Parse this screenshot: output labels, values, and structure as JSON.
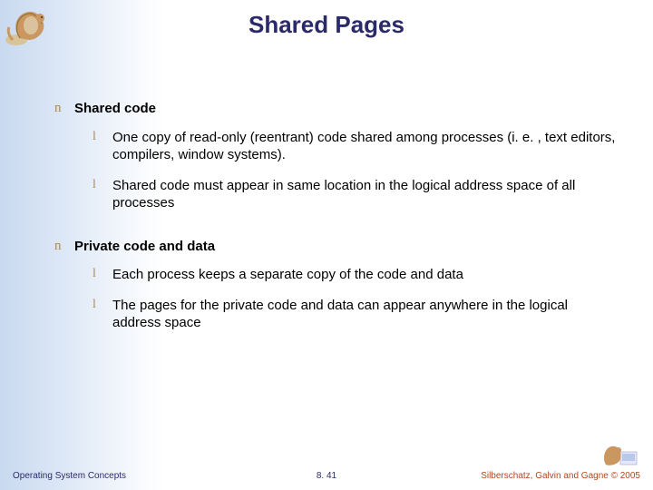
{
  "title": "Shared Pages",
  "sections": [
    {
      "label": "Shared code",
      "items": [
        "One copy of read-only (reentrant) code shared among processes (i. e. , text editors, compilers, window systems).",
        "Shared code must appear in same location in the logical address space of all processes"
      ]
    },
    {
      "label": "Private code and data",
      "items": [
        "Each process keeps a separate copy of the code and data",
        "The pages for the private code and data can appear anywhere in the logical address space"
      ]
    }
  ],
  "footer": {
    "left": "Operating System Concepts",
    "center": "8. 41",
    "right": "Silberschatz, Galvin and Gagne © 2005"
  }
}
